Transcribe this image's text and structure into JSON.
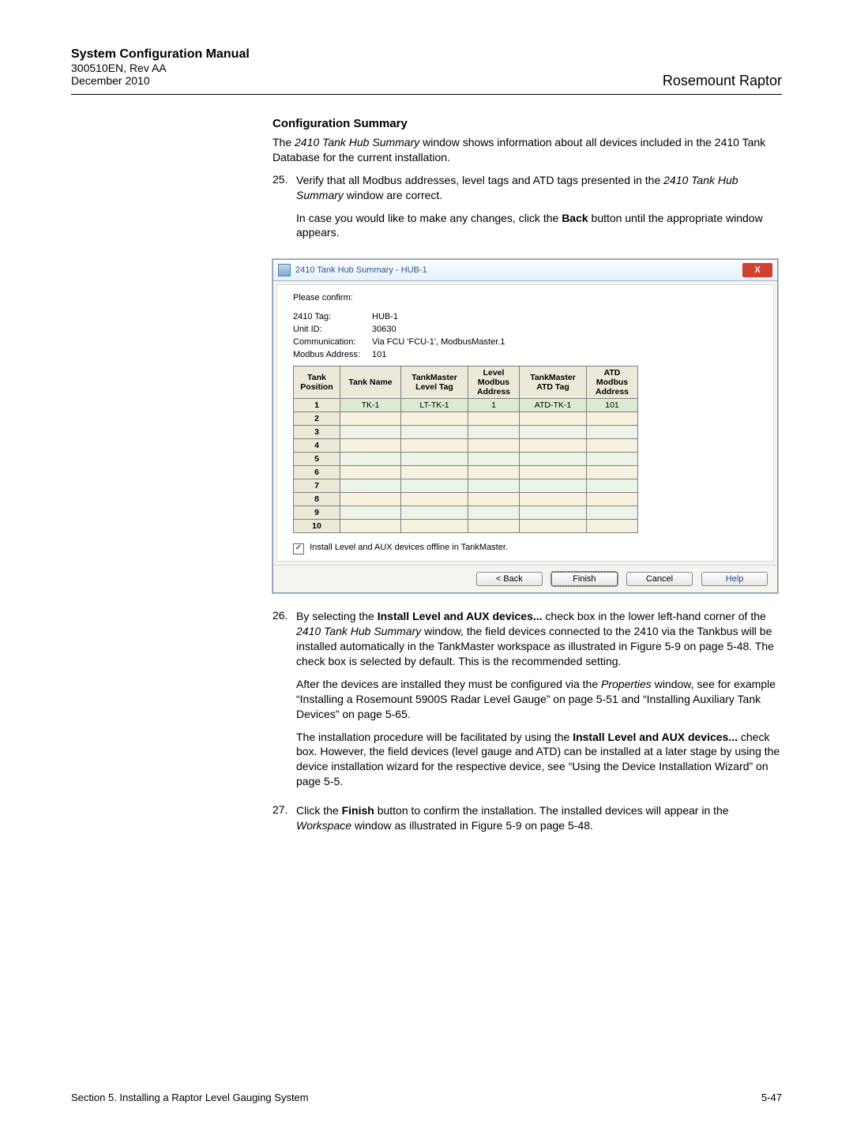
{
  "header": {
    "manual_title": "System Configuration Manual",
    "doc_no": "300510EN, Rev AA",
    "date": "December 2010",
    "product": "Rosemount Raptor"
  },
  "section_title": "Configuration Summary",
  "intro_part1": "The ",
  "intro_italic": "2410 Tank Hub Summary",
  "intro_part2": " window shows information about all devices included in the 2410 Tank Database for the current installation.",
  "steps": {
    "s25": {
      "num": "25.",
      "p1a": "Verify that all Modbus addresses, level tags and ATD tags presented in the ",
      "p1i": "2410 Tank Hub Summary",
      "p1b": " window are correct.",
      "p2a": "In case you would like to make any changes, click the ",
      "p2bold": "Back",
      "p2b": " button until the appropriate window appears."
    },
    "s26": {
      "num": "26.",
      "p1a": "By selecting the ",
      "p1bold": "Install Level and AUX devices...",
      "p1b": " check box in the lower left-hand corner of the ",
      "p1i": "2410 Tank Hub Summary",
      "p1c": " window, the field devices connected to the 2410 via the Tankbus will be installed automatically in the TankMaster workspace as illustrated in Figure 5-9 on page 5-48. The check box is selected by default. This is the recommended setting.",
      "p2a": "After the devices are installed they must be configured via the ",
      "p2i": "Properties",
      "p2b": " window, see for example “Installing a Rosemount 5900S Radar Level Gauge” on page 5-51 and “Installing Auxiliary Tank Devices” on page 5-65.",
      "p3a": "The installation procedure will be facilitated by using the ",
      "p3bold": "Install Level and AUX devices...",
      "p3b": " check box. However, the field devices (level gauge and ATD) can be installed at a later stage by using the device installation wizard for the respective device, see “Using the Device Installation Wizard” on page 5-5."
    },
    "s27": {
      "num": "27.",
      "p1a": "Click the ",
      "p1bold": "Finish",
      "p1b": " button to confirm the installation. The installed devices will appear in the ",
      "p1i": "Workspace",
      "p1c": " window as illustrated in Figure 5-9 on page 5-48."
    }
  },
  "dialog": {
    "title": "2410 Tank Hub Summary - HUB-1",
    "close": "X",
    "please_confirm": "Please confirm:",
    "fields": {
      "tag_lbl": "2410 Tag:",
      "tag_val": "HUB-1",
      "unit_lbl": "Unit ID:",
      "unit_val": "30630",
      "comm_lbl": "Communication:",
      "comm_val": "Via FCU 'FCU-1', ModbusMaster.1",
      "addr_lbl": "Modbus Address:",
      "addr_val": "101"
    },
    "headers": {
      "pos": "Tank Position",
      "name": "Tank Name",
      "ltag": "TankMaster Level Tag",
      "lmod": "Level Modbus Address",
      "atag": "TankMaster ATD Tag",
      "amod": "ATD Modbus Address"
    },
    "rows": [
      {
        "pos": "1",
        "name": "TK-1",
        "ltag": "LT-TK-1",
        "lmod": "1",
        "atag": "ATD-TK-1",
        "amod": "101"
      },
      {
        "pos": "2",
        "name": "",
        "ltag": "",
        "lmod": "",
        "atag": "",
        "amod": ""
      },
      {
        "pos": "3",
        "name": "",
        "ltag": "",
        "lmod": "",
        "atag": "",
        "amod": ""
      },
      {
        "pos": "4",
        "name": "",
        "ltag": "",
        "lmod": "",
        "atag": "",
        "amod": ""
      },
      {
        "pos": "5",
        "name": "",
        "ltag": "",
        "lmod": "",
        "atag": "",
        "amod": ""
      },
      {
        "pos": "6",
        "name": "",
        "ltag": "",
        "lmod": "",
        "atag": "",
        "amod": ""
      },
      {
        "pos": "7",
        "name": "",
        "ltag": "",
        "lmod": "",
        "atag": "",
        "amod": ""
      },
      {
        "pos": "8",
        "name": "",
        "ltag": "",
        "lmod": "",
        "atag": "",
        "amod": ""
      },
      {
        "pos": "9",
        "name": "",
        "ltag": "",
        "lmod": "",
        "atag": "",
        "amod": ""
      },
      {
        "pos": "10",
        "name": "",
        "ltag": "",
        "lmod": "",
        "atag": "",
        "amod": ""
      }
    ],
    "checkbox_mark": "✓",
    "checkbox_label": "Install Level and AUX devices offline in TankMaster.",
    "buttons": {
      "back": "< Back",
      "finish": "Finish",
      "cancel": "Cancel",
      "help": "Help"
    }
  },
  "footer": {
    "section": "Section 5. Installing a Raptor Level Gauging System",
    "page": "5-47"
  }
}
